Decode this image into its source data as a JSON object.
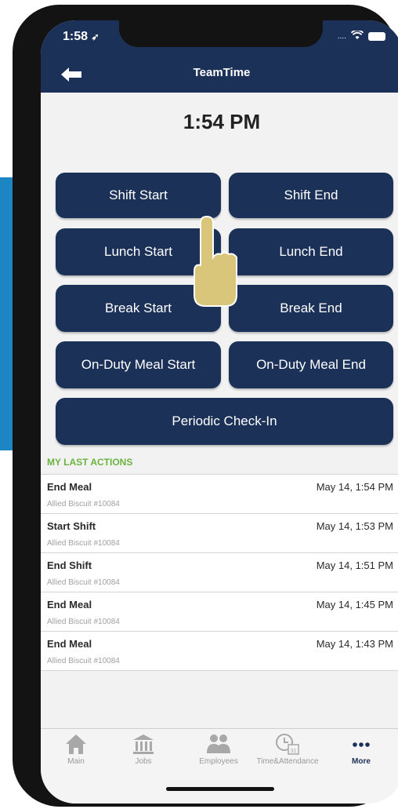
{
  "status_bar": {
    "time": "1:58",
    "signal": "....",
    "wifi": "wifi-icon",
    "battery": "battery-icon"
  },
  "header": {
    "title": "TeamTime",
    "back_icon": "back-arrow-icon"
  },
  "clock": {
    "time": "1:54 PM"
  },
  "buttons": {
    "shift_start": "Shift Start",
    "shift_end": "Shift End",
    "lunch_start": "Lunch Start",
    "lunch_end": "Lunch End",
    "break_start": "Break Start",
    "break_end": "Break End",
    "on_duty_meal_start": "On-Duty Meal Start",
    "on_duty_meal_end": "On-Duty Meal End",
    "periodic_check_in": "Periodic Check-In"
  },
  "last_actions": {
    "heading": "MY LAST ACTIONS",
    "items": [
      {
        "title": "End Meal",
        "location": "Allied Biscuit #10084",
        "time": "May 14, 1:54 PM"
      },
      {
        "title": "Start Shift",
        "location": "Allied Biscuit #10084",
        "time": "May 14, 1:53 PM"
      },
      {
        "title": "End Shift",
        "location": "Allied Biscuit #10084",
        "time": "May 14, 1:51 PM"
      },
      {
        "title": "End Meal",
        "location": "Allied Biscuit #10084",
        "time": "May 14, 1:45 PM"
      },
      {
        "title": "End Meal",
        "location": "Allied Biscuit #10084",
        "time": "May 14, 1:43 PM"
      }
    ]
  },
  "tab_bar": {
    "tabs": [
      {
        "label": "Main",
        "icon": "house-icon"
      },
      {
        "label": "Jobs",
        "icon": "bank-icon"
      },
      {
        "label": "Employees",
        "icon": "people-icon"
      },
      {
        "label": "Time&Attendance",
        "icon": "clock-calendar-icon",
        "calendar_day": "31"
      },
      {
        "label": "More",
        "icon": "more-dots-icon",
        "active": true
      }
    ]
  },
  "colors": {
    "primary": "#1c3158",
    "accent_green": "#6cb33e",
    "side_strip": "#1b86c1",
    "hand": "#d9c67a"
  }
}
